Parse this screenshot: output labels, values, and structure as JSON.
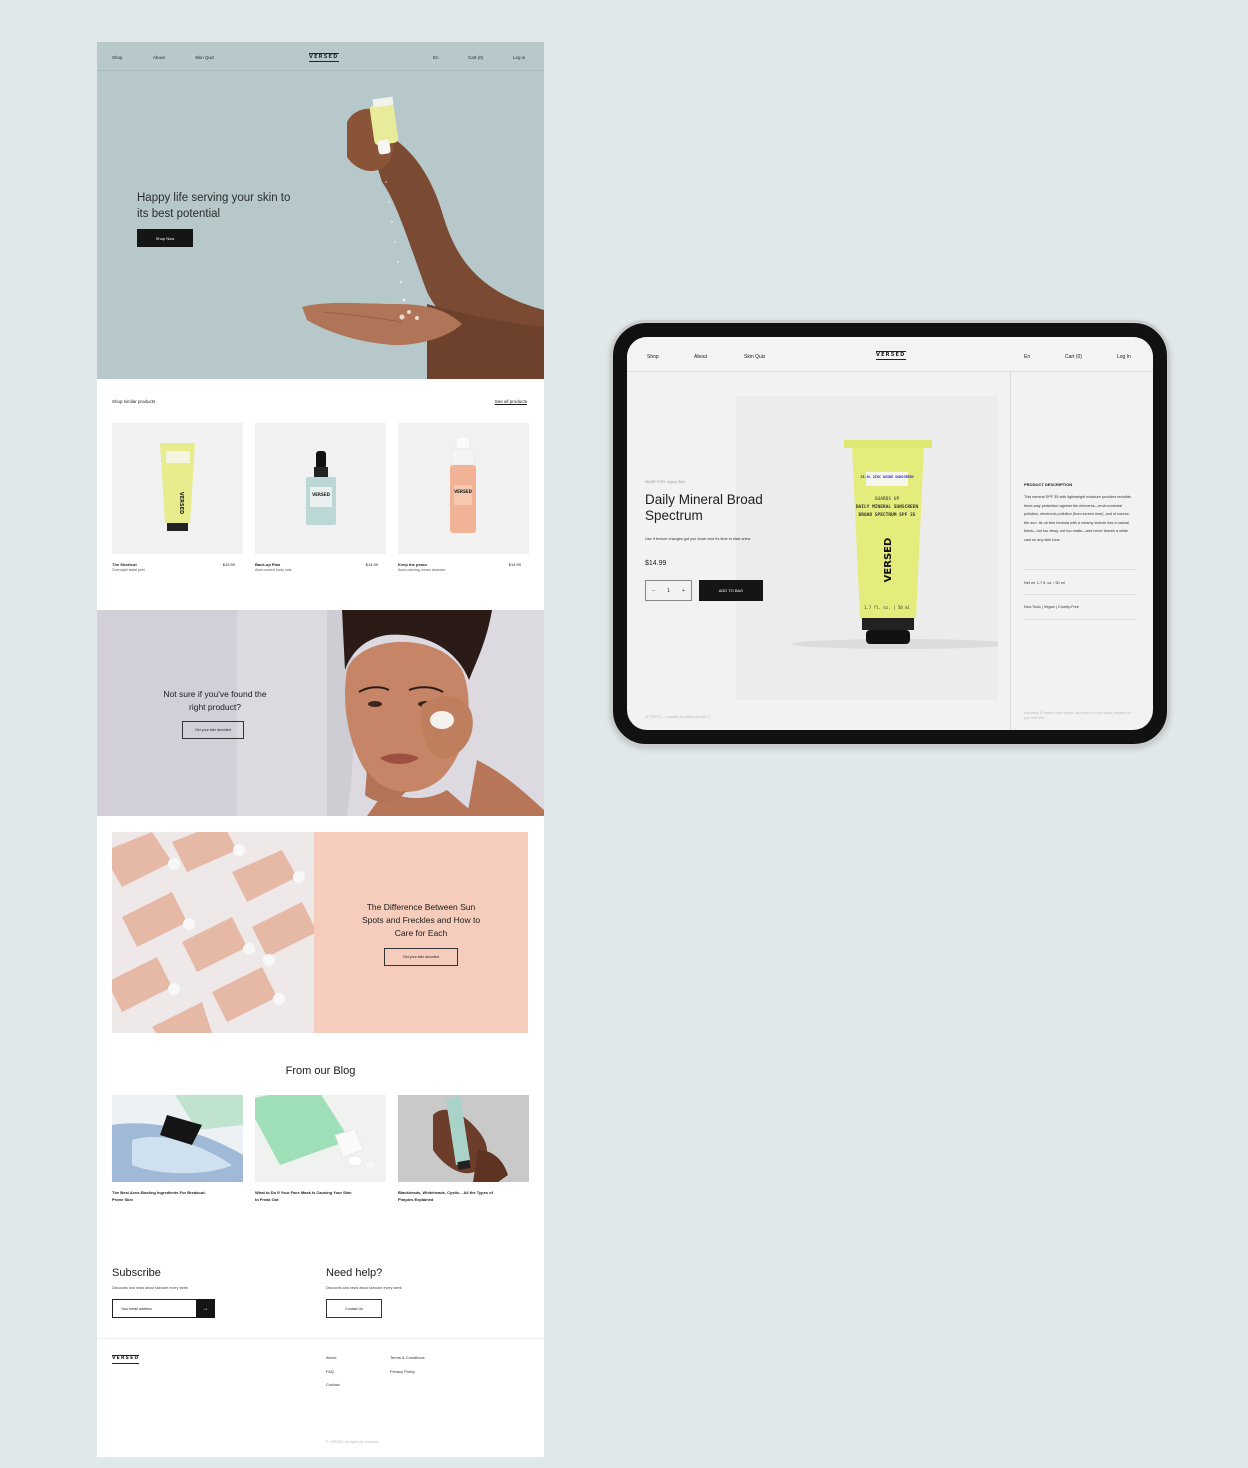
{
  "website": {
    "nav": {
      "shop": "Shop",
      "about": "About",
      "quiz": "Skin Quiz",
      "logo": "VERSED",
      "lang": "En",
      "cart": "Cart (0)",
      "login": "Log in"
    },
    "hero": {
      "title": "Happy life serving your skin to its best potential",
      "button": "Shop Now"
    },
    "similar": {
      "title": "Shop similar products",
      "see_all": "See all products",
      "products": [
        {
          "name": "The Shortcut",
          "sub": "Overnight facial peel",
          "price": "$19.99"
        },
        {
          "name": "Back-up Plan",
          "sub": "Acne-control body mist",
          "price": "$14.99"
        },
        {
          "name": "Keep the peace",
          "sub": "Acne-calming cream cleanser",
          "price": "$14.99"
        }
      ]
    },
    "quiz": {
      "title": "Not sure if you've found the right product?",
      "button": "Get your skin decoded"
    },
    "article": {
      "title": "The Difference Between Sun Spots and Freckles and How to Care for Each",
      "button": "Get your skin decoded"
    },
    "blog": {
      "title": "From our Blog",
      "posts": [
        {
          "title": "The Best Acne-Busting Ingredients For Breakout-Prone Skin"
        },
        {
          "title": "What to Do If Your Face Mask Is Causing Your Skin to Freak Out"
        },
        {
          "title": "Blackheads, Whiteheads, Cystic... All the Types of Pimples Explained"
        }
      ]
    },
    "subscribe": {
      "title": "Subscribe",
      "text": "Discounts and news about skincare every week",
      "placeholder": "Your email address",
      "arrow": "→"
    },
    "help": {
      "title": "Need help?",
      "text": "Discounts and news about skincare every week",
      "button": "Contact Us"
    },
    "footer": {
      "logo": "VERSED",
      "about": "About",
      "faq": "FAQ",
      "contact": "Contact",
      "terms": "Terms & Conditions",
      "privacy": "Privacy Policy",
      "copyright": "© VERSED. All rights are reserved."
    }
  },
  "tablet": {
    "nav": {
      "shop": "Shop",
      "about": "About",
      "quiz": "Skin Quiz",
      "logo": "VERSED",
      "lang": "En",
      "cart": "Cart (0)",
      "login": "Log In"
    },
    "product": {
      "category": "MADE FOR: Aging Skin",
      "name": "Daily Mineral Broad Spectrum",
      "desc": "Use if texture changes got you down and it's time to start anew.",
      "price": "$14.99",
      "qty": "1",
      "minus": "−",
      "plus": "+",
      "add": "ADD TO BAG"
    },
    "details": {
      "title": "PRODUCT DESCRIPTION",
      "text": "This mineral SPF 35 with lightweight moisture provides invisible, three-way protection against the elements—environmental pollution, electronic pollution (from screen time), and of course, the sun. Its oil-free formula with a creamy texture has a natural finish—not too dewy, not too matte—and never leaves a white cast on any skin tone.",
      "net": "Net wt. 1.7 fl. oz. / 50 ml",
      "tags": "Non-Toxic  |  Vegan  |  Cruelty-Free"
    },
    "footer_left": "AFTERPAY — available for orders over $35 ⓘ",
    "footer_right": "Use within 12 months once opened, and keep it on your vanity, prepared for your best shot."
  },
  "tube_label": {
    "spf": "25.0% ZINC OXIDE SUNSCREEN",
    "line1": "GUARDS UP",
    "line2": "DAILY MINERAL SUNSCREEN",
    "line3": "BROAD SPECTRUM SPF 35",
    "brand": "VERSED",
    "size": "1.7 fl. oz. | 50 ml"
  }
}
